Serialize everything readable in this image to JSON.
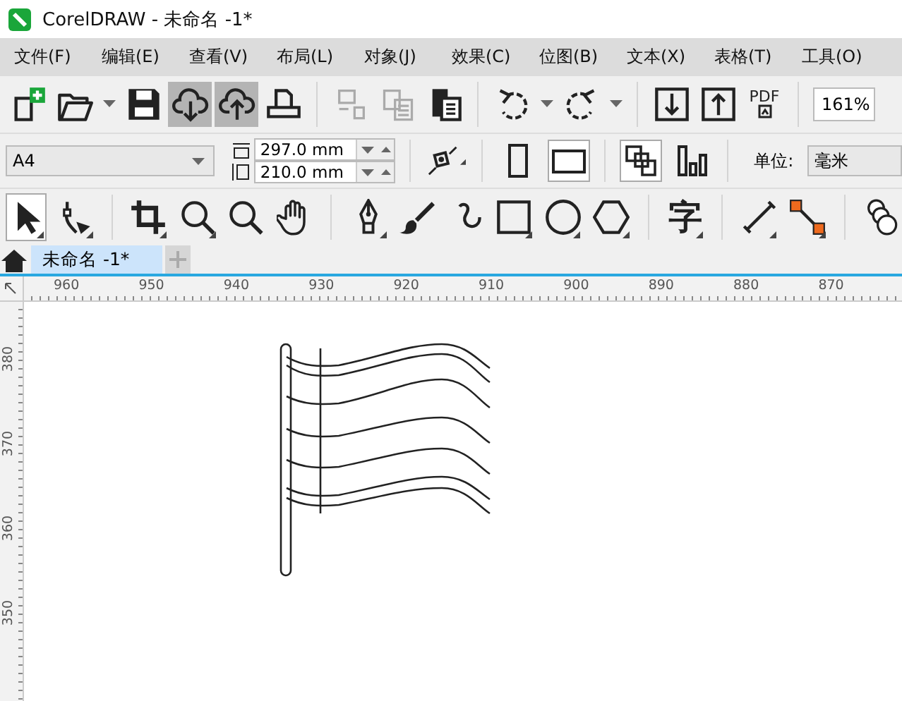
{
  "window": {
    "title": "CorelDRAW - 未命名 -1*"
  },
  "menu": [
    "文件(F)",
    "编辑(E)",
    "查看(V)",
    "布局(L)",
    "对象(J)",
    "效果(C)",
    "位图(B)",
    "文本(X)",
    "表格(T)",
    "工具(O)"
  ],
  "standard_toolbar": [
    {
      "kind": "new",
      "highlighted": false,
      "disabled": false
    },
    {
      "kind": "open",
      "highlighted": false,
      "disabled": false
    },
    {
      "kind": "caret"
    },
    {
      "kind": "save",
      "highlighted": false,
      "disabled": false
    },
    {
      "kind": "cloud-down",
      "highlighted": true,
      "disabled": false
    },
    {
      "kind": "cloud-up",
      "highlighted": true,
      "disabled": false
    },
    {
      "kind": "print",
      "highlighted": false,
      "disabled": false
    },
    {
      "kind": "sep"
    },
    {
      "kind": "cut",
      "highlighted": false,
      "disabled": true
    },
    {
      "kind": "copy",
      "highlighted": false,
      "disabled": true
    },
    {
      "kind": "paste",
      "highlighted": false,
      "disabled": false
    },
    {
      "kind": "sep"
    },
    {
      "kind": "undo",
      "highlighted": false,
      "disabled": false
    },
    {
      "kind": "caret"
    },
    {
      "kind": "redo",
      "highlighted": false,
      "disabled": false
    },
    {
      "kind": "caret"
    },
    {
      "kind": "sep"
    },
    {
      "kind": "import",
      "highlighted": false,
      "disabled": false
    },
    {
      "kind": "export",
      "highlighted": false,
      "disabled": false
    },
    {
      "kind": "pdf",
      "label": "PDF",
      "highlighted": false,
      "disabled": false
    }
  ],
  "zoom": {
    "value": "161%"
  },
  "property_bar": {
    "page_size": "A4",
    "width": "297.0 mm",
    "height": "210.0 mm",
    "orientation": [
      {
        "kind": "portrait",
        "selected": false
      },
      {
        "kind": "landscape",
        "selected": true
      }
    ],
    "page_scope": [
      {
        "kind": "all-pages",
        "selected": true
      },
      {
        "kind": "current-page",
        "selected": false
      }
    ],
    "unit_label": "单位:",
    "unit": "毫米"
  },
  "toolbox": [
    {
      "kind": "pick",
      "selected": true,
      "flyout": true
    },
    {
      "kind": "shape",
      "selected": false,
      "flyout": true
    },
    {
      "kind": "sep"
    },
    {
      "kind": "crop",
      "selected": false,
      "flyout": true
    },
    {
      "kind": "zoom",
      "selected": false,
      "flyout": true
    },
    {
      "kind": "zoom",
      "selected": false,
      "flyout": false
    },
    {
      "kind": "pan",
      "selected": false,
      "flyout": false
    },
    {
      "kind": "sep"
    },
    {
      "kind": "pen",
      "selected": false,
      "flyout": true
    },
    {
      "kind": "brush",
      "selected": false,
      "flyout": false
    },
    {
      "kind": "spiral",
      "selected": false,
      "flyout": false
    },
    {
      "kind": "rect",
      "selected": false,
      "flyout": true
    },
    {
      "kind": "ellipse",
      "selected": false,
      "flyout": true
    },
    {
      "kind": "polygon",
      "selected": false,
      "flyout": true
    },
    {
      "kind": "sep"
    },
    {
      "kind": "text",
      "label": "字",
      "selected": false,
      "flyout": true
    },
    {
      "kind": "sep"
    },
    {
      "kind": "dimension",
      "selected": false,
      "flyout": true
    },
    {
      "kind": "connector",
      "selected": false,
      "flyout": true
    },
    {
      "kind": "sep"
    },
    {
      "kind": "blend",
      "selected": false,
      "flyout": false
    }
  ],
  "document_tabs": [
    {
      "label": "未命名 -1*",
      "selected": true
    }
  ],
  "rulers": {
    "horizontal": [
      "960",
      "950",
      "940",
      "930",
      "920",
      "910",
      "900",
      "890",
      "880",
      "870"
    ],
    "vertical": [
      "380",
      "370",
      "360",
      "350"
    ]
  }
}
